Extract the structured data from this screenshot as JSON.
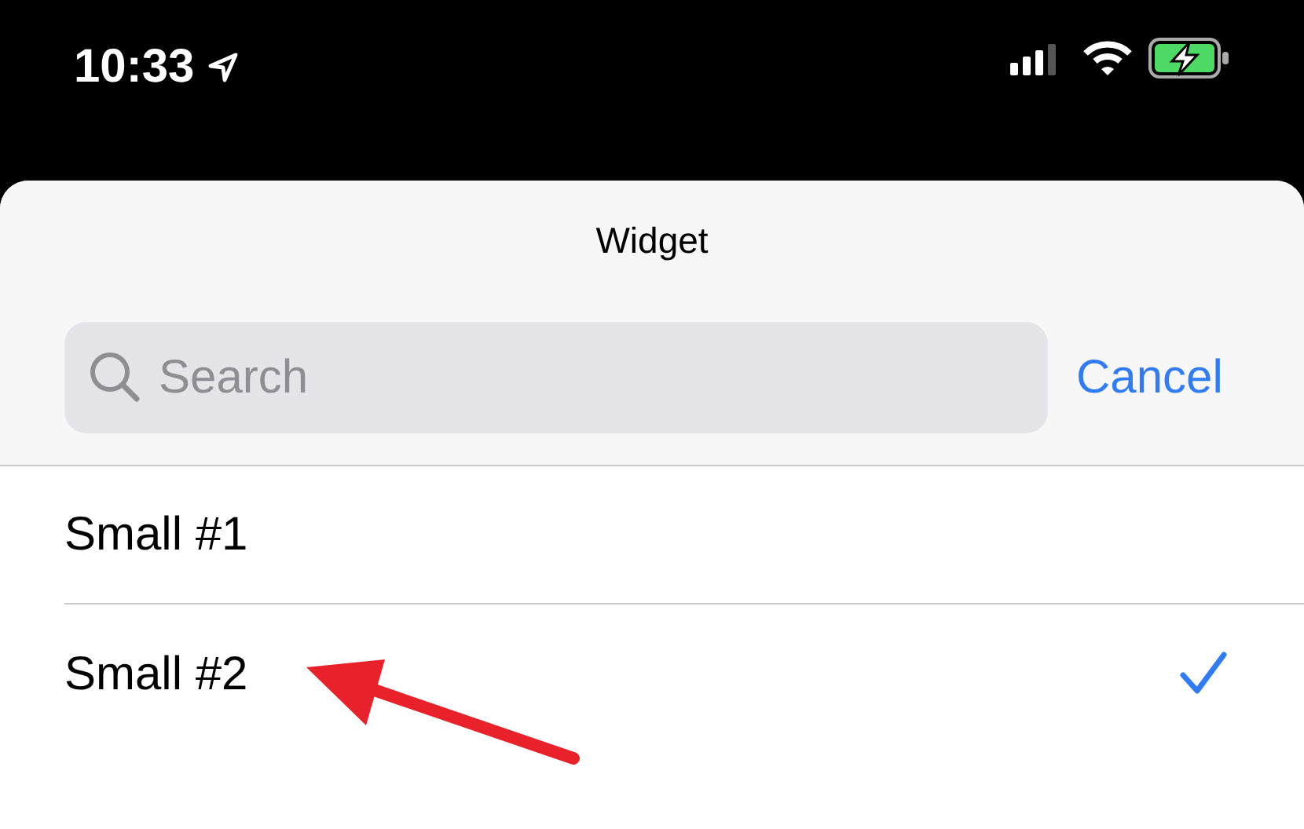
{
  "status_bar": {
    "time": "10:33",
    "battery_charging": true
  },
  "sheet": {
    "title": "Widget",
    "search": {
      "placeholder": "Search"
    },
    "cancel": "Cancel"
  },
  "items": [
    {
      "label": "Small #1",
      "selected": false
    },
    {
      "label": "Small #2",
      "selected": true
    }
  ]
}
